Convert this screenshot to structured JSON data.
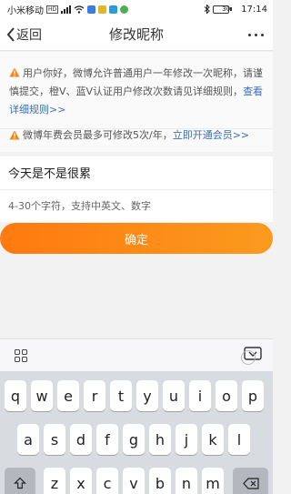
{
  "status_bar": {
    "carrier": "小米移动",
    "hd": "HD",
    "battery_level": "30",
    "time": "17:14"
  },
  "nav": {
    "back_label": "返回",
    "title": "修改昵称"
  },
  "notice1": {
    "text": "用户你好，微博允许普通用户一年修改一次昵称，请谨慎提交，橙V、蓝V认证用户修改次数请见详细规则，",
    "link": "查看详细规则>>"
  },
  "notice2": {
    "text": "微博年费会员最多可修改5次/年，",
    "link": "立即开通会员>>"
  },
  "form": {
    "nickname_value": "今天是不是很累",
    "hint": "4-30个字符，支持中英文、数字",
    "confirm_label": "确定"
  },
  "keyboard": {
    "row1": [
      "q",
      "w",
      "e",
      "r",
      "t",
      "y",
      "u",
      "i",
      "o",
      "p"
    ],
    "row2": [
      "a",
      "s",
      "d",
      "f",
      "g",
      "h",
      "j",
      "k",
      "l"
    ],
    "row3": [
      "z",
      "x",
      "c",
      "v",
      "b",
      "n",
      "m"
    ]
  },
  "icons": {
    "warning_color": "#f08a1e",
    "accent": "#ff7a0f",
    "link_color": "#3a6fb8"
  }
}
